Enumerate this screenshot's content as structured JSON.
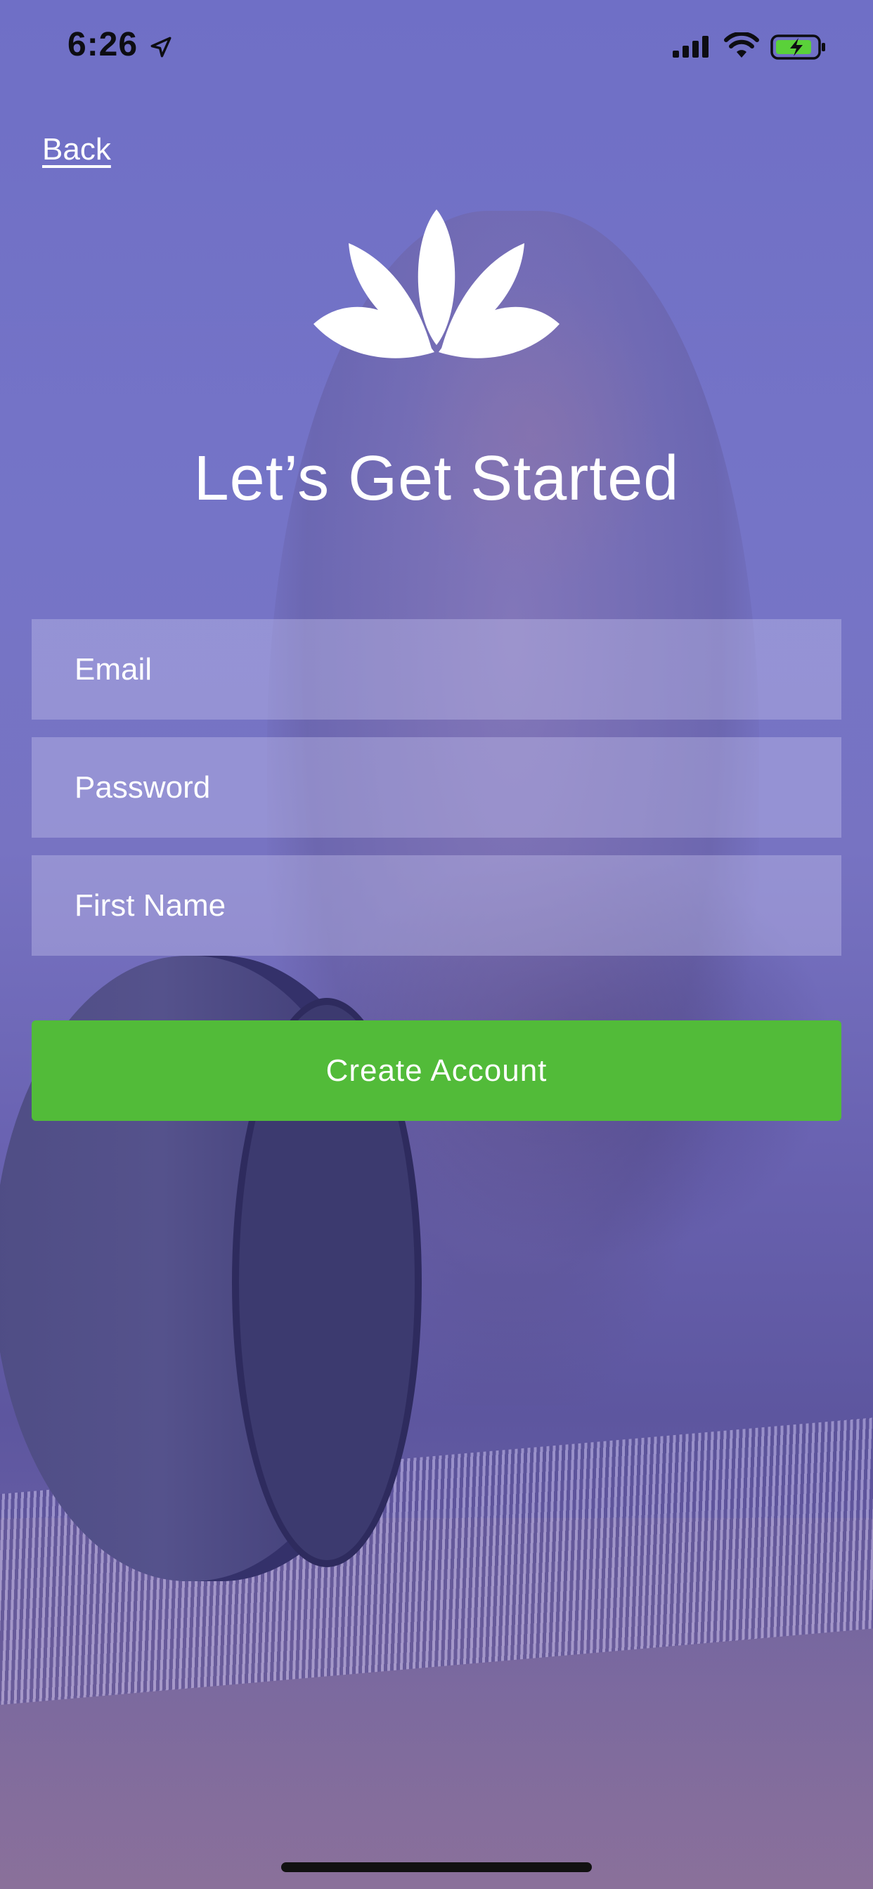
{
  "status_bar": {
    "time": "6:26"
  },
  "nav": {
    "back_label": "Back"
  },
  "header": {
    "title": "Let’s Get Started",
    "logo_icon": "lotus-icon"
  },
  "form": {
    "email_placeholder": "Email",
    "password_placeholder": "Password",
    "first_name_placeholder": "First Name",
    "submit_label": "Create Account"
  },
  "colors": {
    "overlay": "#7370c4",
    "primary_button": "#52bb39",
    "text": "#ffffff"
  }
}
